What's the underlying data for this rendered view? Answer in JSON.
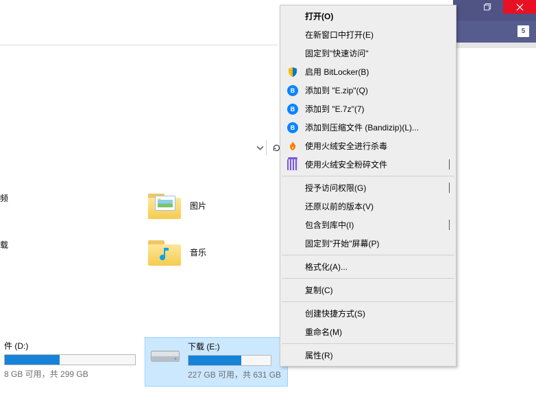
{
  "title_bar": {
    "badge_value": "5"
  },
  "left_panel": {
    "item1_suffix": "频",
    "item2_suffix": "载"
  },
  "folders": {
    "pictures": "图片",
    "music": "音乐"
  },
  "drives": {
    "d": {
      "label_suffix": "件 (D:)",
      "caption_suffix": "8 GB 可用，共 299 GB",
      "fill_percent": 42
    },
    "e": {
      "label": "下载 (E:)",
      "caption": "227 GB 可用，共 631 GB",
      "fill_percent": 64
    }
  },
  "context_menu": {
    "open": "打开(O)",
    "open_new_window": "在新窗口中打开(E)",
    "pin_quick_access": "固定到\"快速访问\"",
    "bitlocker": "启用 BitLocker(B)",
    "add_zip": "添加到 \"E.zip\"(Q)",
    "add_7z": "添加到 \"E.7z\"(7)",
    "add_compress": "添加到压缩文件 (Bandizip)(L)...",
    "huorong_scan": "使用火绒安全进行杀毒",
    "huorong_shred": "使用火绒安全粉碎文件",
    "grant_access": "授予访问权限(G)",
    "restore_prev": "还原以前的版本(V)",
    "include_library": "包含到库中(I)",
    "pin_start": "固定到\"开始\"屏幕(P)",
    "format": "格式化(A)...",
    "copy": "复制(C)",
    "create_shortcut": "创建快捷方式(S)",
    "rename": "重命名(M)",
    "properties": "属性(R)"
  }
}
